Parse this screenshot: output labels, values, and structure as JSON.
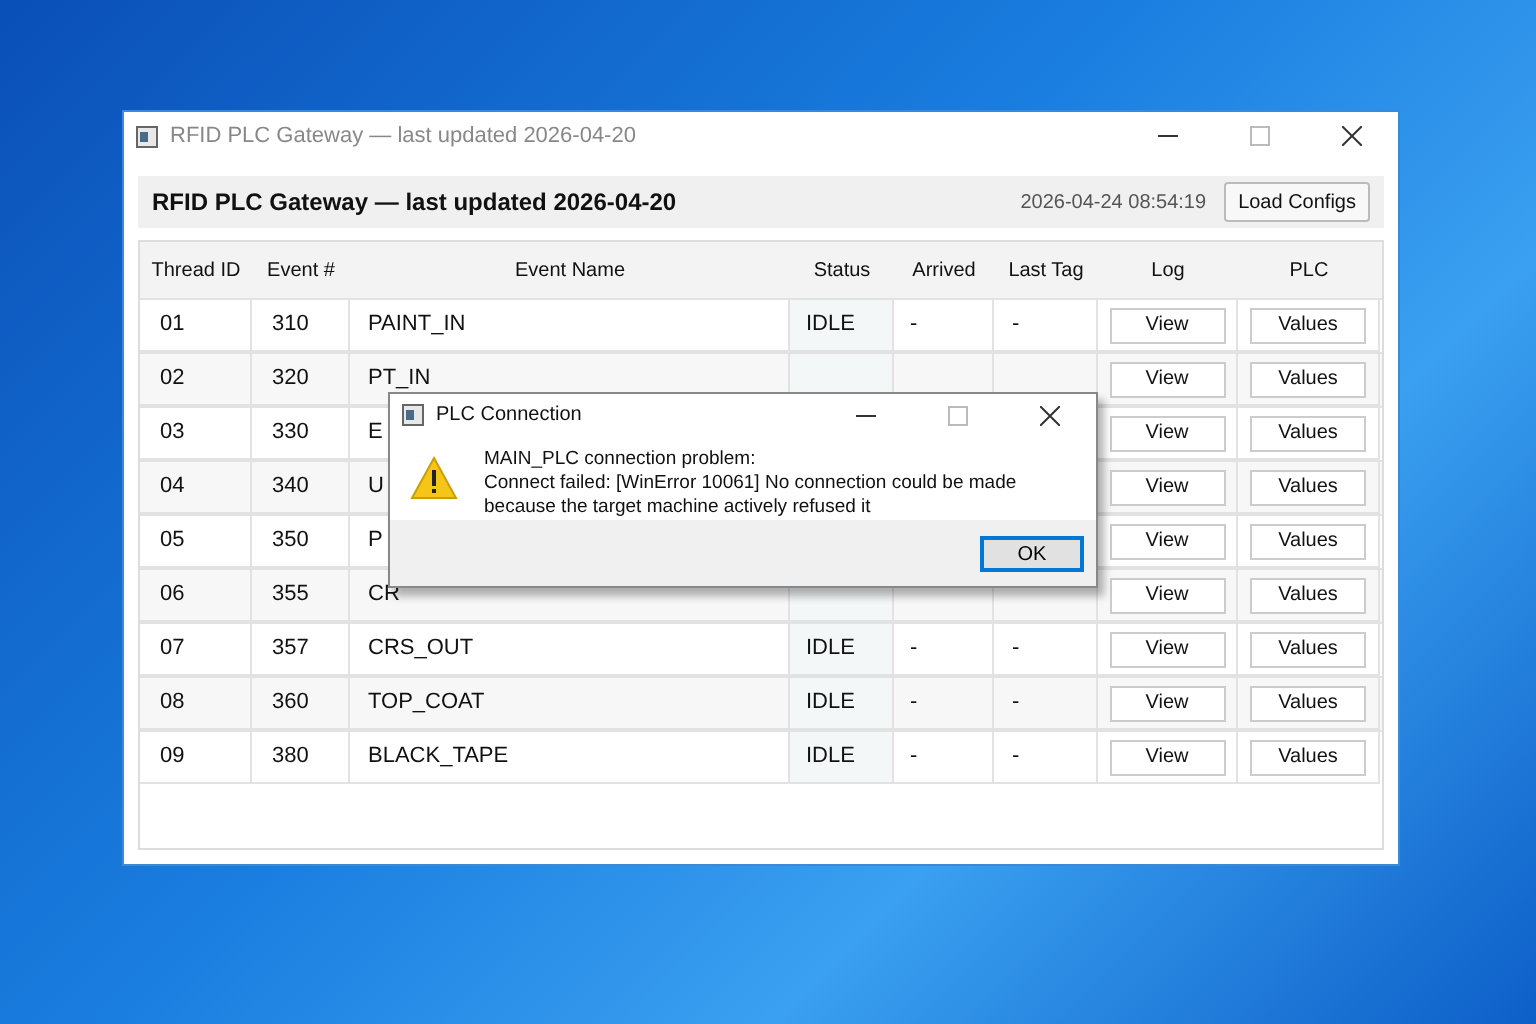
{
  "window": {
    "title": "RFID PLC Gateway — last updated 2026-04-20"
  },
  "header": {
    "title": "RFID PLC Gateway — last updated 2026-04-20",
    "timestamp": "2026-04-24 08:54:19",
    "button": "Load Configs"
  },
  "table": {
    "columns": [
      "Thread ID",
      "Event #",
      "Event Name",
      "Status",
      "Arrived",
      "Last Tag",
      "Log",
      "PLC"
    ],
    "rows": [
      {
        "thread_id": "01",
        "event": "310",
        "name": "PAINT_IN",
        "status": "IDLE",
        "arrived": "-",
        "last_tag": "-",
        "log": "View",
        "plc": "Values"
      },
      {
        "thread_id": "02",
        "event": "320",
        "name": "PT_IN",
        "log": "View",
        "plc": "Values"
      },
      {
        "thread_id": "03",
        "event": "330",
        "name": "E",
        "log": "View",
        "plc": "Values"
      },
      {
        "thread_id": "04",
        "event": "340",
        "name": "U",
        "log": "View",
        "plc": "Values"
      },
      {
        "thread_id": "05",
        "event": "350",
        "name": "P",
        "log": "View",
        "plc": "Values"
      },
      {
        "thread_id": "06",
        "event": "355",
        "name": "CR",
        "log": "View",
        "plc": "Values"
      },
      {
        "thread_id": "07",
        "event": "357",
        "name": "CRS_OUT",
        "status": "IDLE",
        "arrived": "-",
        "last_tag": "-",
        "log": "View",
        "plc": "Values"
      },
      {
        "thread_id": "08",
        "event": "360",
        "name": "TOP_COAT",
        "status": "IDLE",
        "arrived": "-",
        "last_tag": "-",
        "log": "View",
        "plc": "Values"
      },
      {
        "thread_id": "09",
        "event": "380",
        "name": "BLACK_TAPE",
        "status": "IDLE",
        "arrived": "-",
        "last_tag": "-",
        "log": "View",
        "plc": "Values"
      }
    ]
  },
  "dialog": {
    "title": "PLC Connection",
    "message_lines": [
      "MAIN_PLC connection problem:",
      "Connect failed: [WinError 10061] No connection could be made because the target machine actively refused it"
    ],
    "button": "OK"
  }
}
